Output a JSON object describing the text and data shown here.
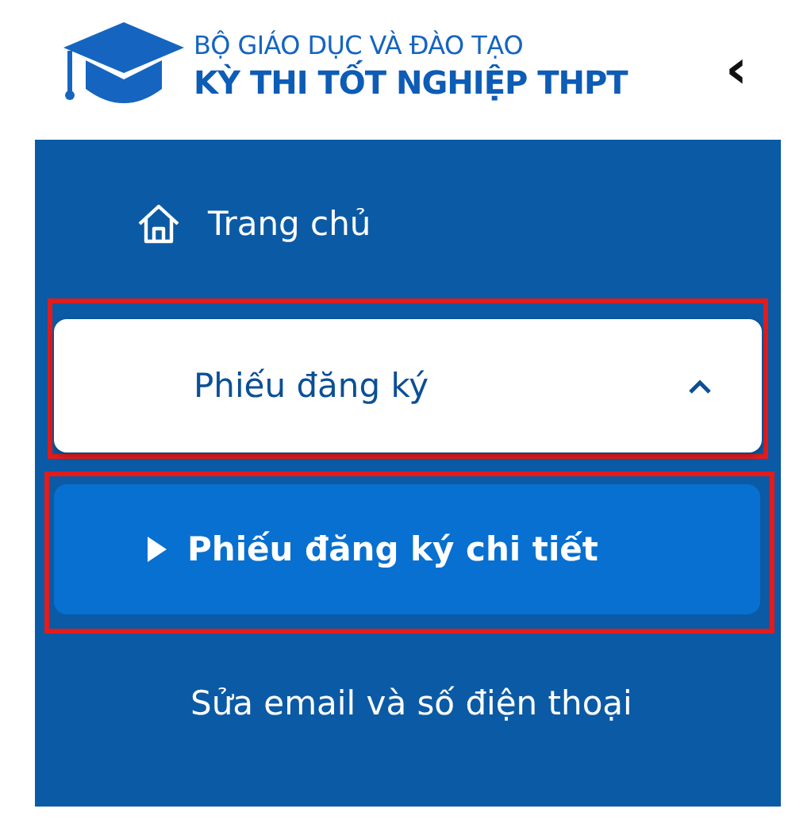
{
  "header": {
    "ministry": "BỘ GIÁO DỤC VÀ ĐÀO TẠO",
    "exam": "KỲ THI TỐT NGHIỆP THPT",
    "collapse_icon": "‹"
  },
  "menu": [
    {
      "kind": "link",
      "label": "Trang chủ",
      "highlighted": false
    },
    {
      "kind": "group",
      "label": "Phiếu đăng ký",
      "expanded": true,
      "highlighted": true,
      "children": [
        {
          "label": "Phiếu đăng ký chi tiết",
          "selected": true,
          "highlighted": true
        },
        {
          "label": "Sửa email và số điện thoại",
          "selected": false,
          "highlighted": false
        }
      ]
    }
  ]
}
